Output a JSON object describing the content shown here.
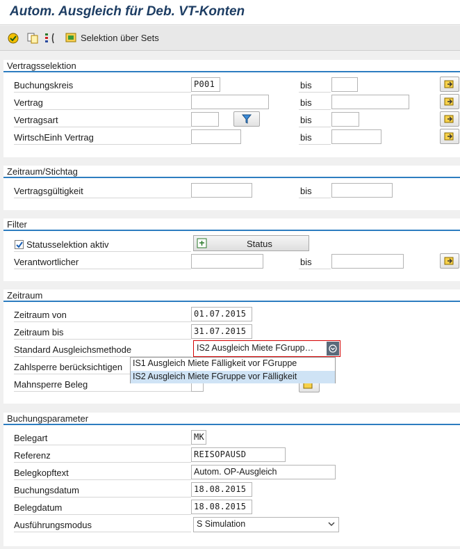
{
  "title": "Autom. Ausgleich für Deb. VT-Konten",
  "toolbar": {
    "icons": [
      "execute-icon",
      "copy-variant-icon",
      "selection-options-icon",
      "sets-icon"
    ],
    "sets_label": "Selektion über Sets"
  },
  "bis": "bis",
  "vertragsselektion": {
    "header": "Vertragsselektion",
    "rows": [
      {
        "label": "Buchungskreis",
        "from": "P001",
        "to": ""
      },
      {
        "label": "Vertrag",
        "from": "",
        "to": ""
      },
      {
        "label": "Vertragsart",
        "from": "",
        "to": ""
      },
      {
        "label": "WirtschEinh Vertrag",
        "from": "",
        "to": ""
      }
    ]
  },
  "zeitraum_stichtag": {
    "header": "Zeitraum/Stichtag",
    "label": "Vertragsgültigkeit",
    "from": "",
    "to": ""
  },
  "filter": {
    "header": "Filter",
    "status_checkbox_label": "Statusselektion aktiv",
    "status_checked": true,
    "status_button": "Status",
    "verantwortlicher_label": "Verantwortlicher",
    "from": "",
    "to": ""
  },
  "zeitraum": {
    "header": "Zeitraum",
    "von_label": "Zeitraum von",
    "von_value": "01.07.2015",
    "bis_label": "Zeitraum bis",
    "bis_value": "31.07.2015",
    "methode_label": "Standard Ausgleichsmethode",
    "methode_value": "IS2 Ausgleich Miete FGrupp…",
    "zahlsperre_label": "Zahlsperre berücksichtigen",
    "mahnsperre_label": "Mahnsperre Beleg",
    "options": [
      "IS1  Ausgleich Miete Fälligkeit vor FGruppe",
      "IS2  Ausgleich Miete FGruppe vor Fälligkeit"
    ]
  },
  "buchungsparameter": {
    "header": "Buchungsparameter",
    "belegart_label": "Belegart",
    "belegart_value": "MK",
    "referenz_label": "Referenz",
    "referenz_value": "REISOPAUSD",
    "belegkopftext_label": "Belegkopftext",
    "belegkopftext_value": "Autom. OP-Ausgleich",
    "buchungsdatum_label": "Buchungsdatum",
    "buchungsdatum_value": "18.08.2015",
    "belegdatum_label": "Belegdatum",
    "belegdatum_value": "18.08.2015",
    "modus_label": "Ausführungsmodus",
    "modus_value": "S Simulation"
  },
  "colors": {
    "accent": "#2d7dc0",
    "title": "#1d3d63",
    "focus": "#d40000"
  }
}
